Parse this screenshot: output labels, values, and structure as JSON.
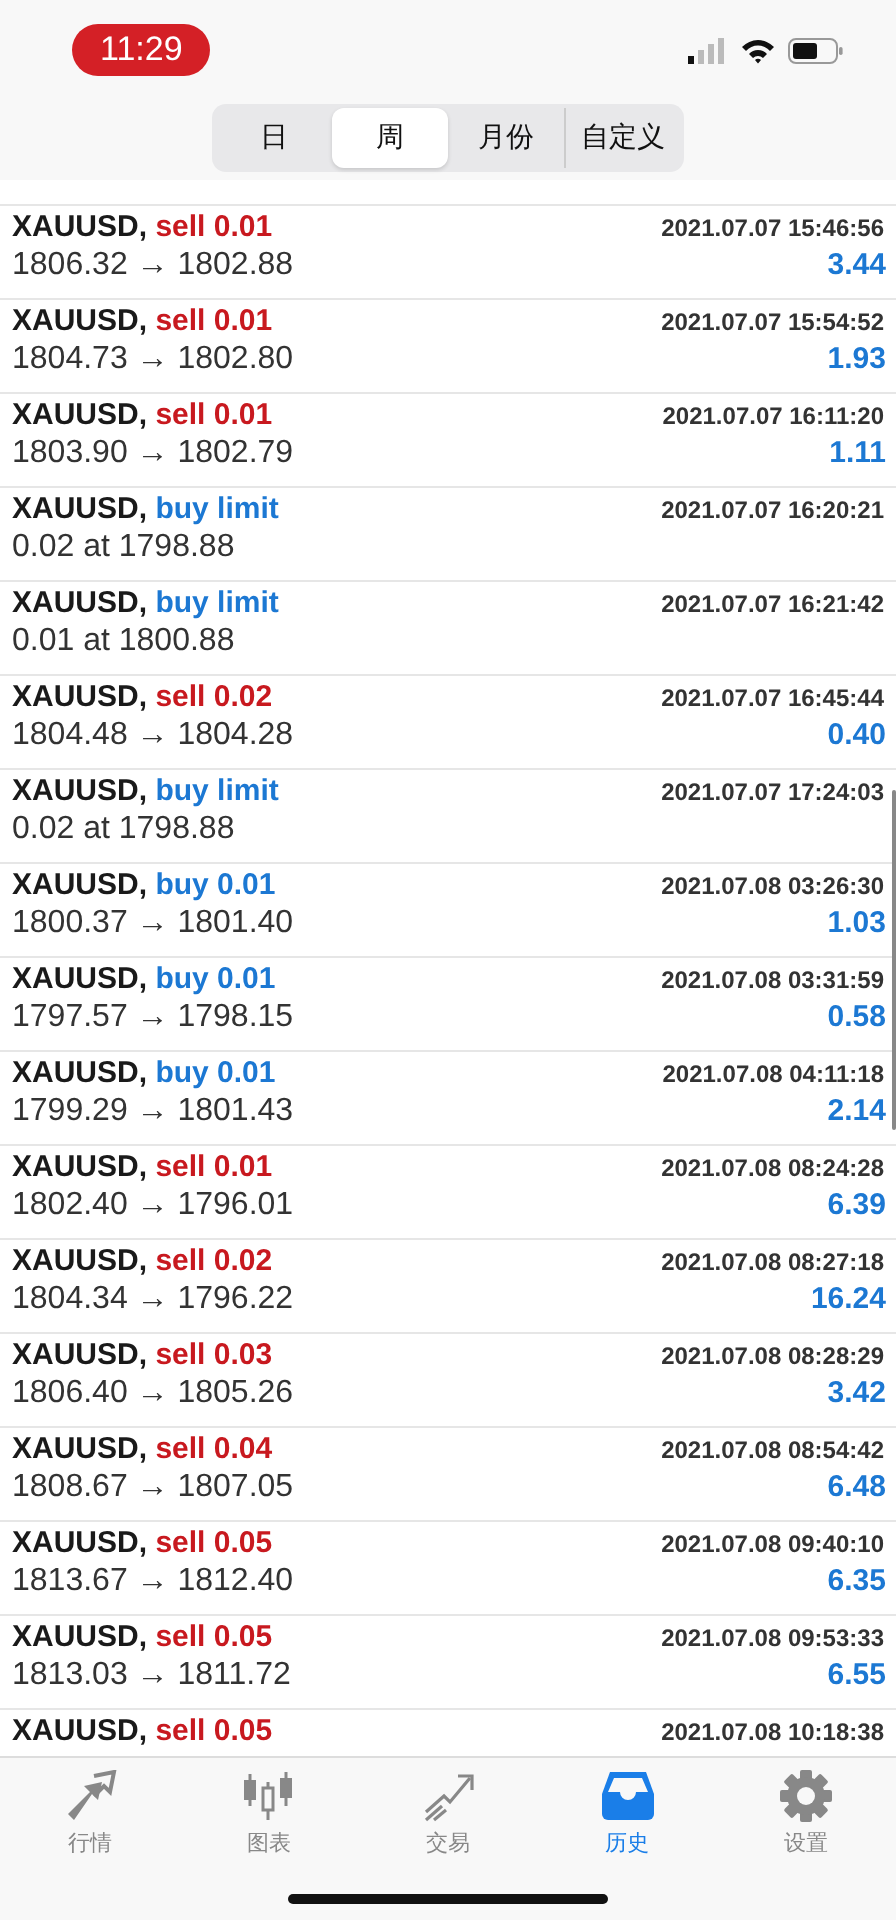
{
  "status_bar": {
    "time": "11:29"
  },
  "periods": [
    {
      "label": "日",
      "selected": false
    },
    {
      "label": "周",
      "selected": true
    },
    {
      "label": "月份",
      "selected": false
    },
    {
      "label": "自定义",
      "selected": false
    }
  ],
  "orders": [
    {
      "symbol": "XAUUSD,",
      "kind": "sell",
      "action": "sell 0.01",
      "time": "2021.07.07 15:46:56",
      "prices": "1806.32 → 1802.88",
      "profit": "3.44"
    },
    {
      "symbol": "XAUUSD,",
      "kind": "sell",
      "action": "sell 0.01",
      "time": "2021.07.07 15:54:52",
      "prices": "1804.73 → 1802.80",
      "profit": "1.93"
    },
    {
      "symbol": "XAUUSD,",
      "kind": "sell",
      "action": "sell 0.01",
      "time": "2021.07.07 16:11:20",
      "prices": "1803.90 → 1802.79",
      "profit": "1.11"
    },
    {
      "symbol": "XAUUSD,",
      "kind": "buy",
      "action": "buy limit",
      "time": "2021.07.07 16:20:21",
      "prices": "0.02 at 1798.88"
    },
    {
      "symbol": "XAUUSD,",
      "kind": "buy",
      "action": "buy limit",
      "time": "2021.07.07 16:21:42",
      "prices": "0.01 at 1800.88"
    },
    {
      "symbol": "XAUUSD,",
      "kind": "sell",
      "action": "sell 0.02",
      "time": "2021.07.07 16:45:44",
      "prices": "1804.48 → 1804.28",
      "profit": "0.40"
    },
    {
      "symbol": "XAUUSD,",
      "kind": "buy",
      "action": "buy limit",
      "time": "2021.07.07 17:24:03",
      "prices": "0.02 at 1798.88"
    },
    {
      "symbol": "XAUUSD,",
      "kind": "buy",
      "action": "buy 0.01",
      "time": "2021.07.08 03:26:30",
      "prices": "1800.37 → 1801.40",
      "profit": "1.03"
    },
    {
      "symbol": "XAUUSD,",
      "kind": "buy",
      "action": "buy 0.01",
      "time": "2021.07.08 03:31:59",
      "prices": "1797.57 → 1798.15",
      "profit": "0.58"
    },
    {
      "symbol": "XAUUSD,",
      "kind": "buy",
      "action": "buy 0.01",
      "time": "2021.07.08 04:11:18",
      "prices": "1799.29 → 1801.43",
      "profit": "2.14"
    },
    {
      "symbol": "XAUUSD,",
      "kind": "sell",
      "action": "sell 0.01",
      "time": "2021.07.08 08:24:28",
      "prices": "1802.40 → 1796.01",
      "profit": "6.39"
    },
    {
      "symbol": "XAUUSD,",
      "kind": "sell",
      "action": "sell 0.02",
      "time": "2021.07.08 08:27:18",
      "prices": "1804.34 → 1796.22",
      "profit": "16.24"
    },
    {
      "symbol": "XAUUSD,",
      "kind": "sell",
      "action": "sell 0.03",
      "time": "2021.07.08 08:28:29",
      "prices": "1806.40 → 1805.26",
      "profit": "3.42"
    },
    {
      "symbol": "XAUUSD,",
      "kind": "sell",
      "action": "sell 0.04",
      "time": "2021.07.08 08:54:42",
      "prices": "1808.67 → 1807.05",
      "profit": "6.48"
    },
    {
      "symbol": "XAUUSD,",
      "kind": "sell",
      "action": "sell 0.05",
      "time": "2021.07.08 09:40:10",
      "prices": "1813.67 → 1812.40",
      "profit": "6.35"
    },
    {
      "symbol": "XAUUSD,",
      "kind": "sell",
      "action": "sell 0.05",
      "time": "2021.07.08 09:53:33",
      "prices": "1813.03 → 1811.72",
      "profit": "6.55"
    },
    {
      "symbol": "XAUUSD,",
      "kind": "sell",
      "action": "sell 0.05",
      "time": "2021.07.08 10:18:38"
    }
  ],
  "tab_bar": [
    {
      "label": "行情",
      "selected": false
    },
    {
      "label": "图表",
      "selected": false
    },
    {
      "label": "交易",
      "selected": false
    },
    {
      "label": "历史",
      "selected": true
    },
    {
      "label": "设置",
      "selected": false
    }
  ]
}
